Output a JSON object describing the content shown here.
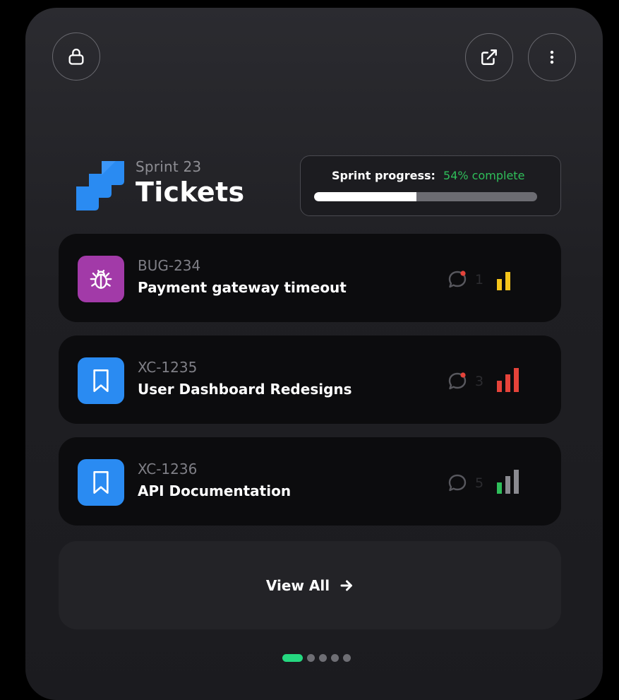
{
  "header": {
    "subtitle": "Sprint 23",
    "title": "Tickets"
  },
  "progress": {
    "label": "Sprint progress:",
    "value_text": "54% complete",
    "value": 0.46
  },
  "tickets": [
    {
      "key": "BUG-234",
      "title": "Payment gateway timeout",
      "type_icon": "bug-icon",
      "type_color": "#a23aa8",
      "comments": "1",
      "comment_unread": true,
      "priority": "medium",
      "priority_color": "#f5c51b"
    },
    {
      "key": "XC-1235",
      "title": "User Dashboard Redesigns",
      "type_icon": "bookmark-icon",
      "type_color": "#2a8bf2",
      "comments": "3",
      "comment_unread": true,
      "priority": "high",
      "priority_color": "#e5433a"
    },
    {
      "key": "XC-1236",
      "title": "API Documentation",
      "type_icon": "bookmark-icon",
      "type_color": "#2a8bf2",
      "comments": "5",
      "comment_unread": false,
      "priority": "low",
      "priority_color": "#2fbf5a"
    }
  ],
  "view_all": {
    "label": "View All"
  },
  "pagination": {
    "pages": 5,
    "active": 1
  },
  "icons": {
    "top_left": "lock-icon",
    "top_right": [
      "external-link-icon",
      "more-vertical-icon"
    ],
    "logo": "jira-logo-icon"
  },
  "colors": {
    "accent_green": "#25d880",
    "brand_blue": "#2a8bf2"
  }
}
